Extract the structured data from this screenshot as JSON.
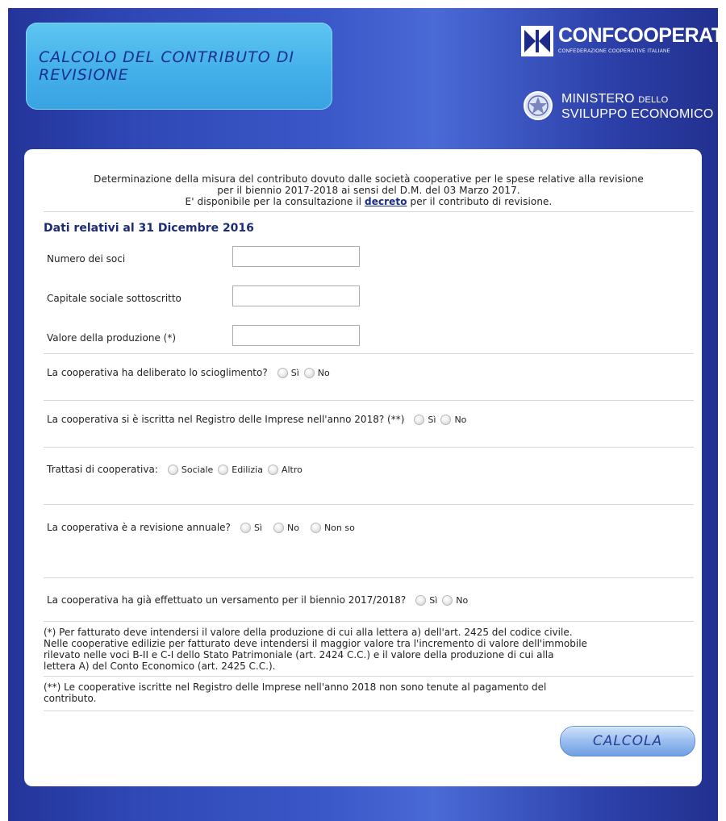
{
  "header": {
    "title": "CALCOLO DEL CONTRIBUTO DI REVISIONE",
    "logo1_name": "CONFCOOPERATIVE",
    "logo1_sub": "CONFEDERAZIONE COOPERATIVE ITALIANE",
    "logo2_line1_a": "MINISTERO ",
    "logo2_line1_b": "DELLO",
    "logo2_line2": "SVILUPPO ECONOMICO"
  },
  "intro": {
    "line1": "Determinazione della misura del contributo dovuto dalle società cooperative per le spese relative alla revisione",
    "line2": "per il biennio 2017-2018 ai sensi del D.M. del 03 Marzo 2017.",
    "line3_pre": "E' disponibile per la consultazione il ",
    "line3_link": "decreto",
    "line3_post": " per il contributo di revisione."
  },
  "section_title": "Dati relativi al 31 Dicembre 2016",
  "fields": {
    "soci_label": "Numero dei soci",
    "soci_value": "",
    "capitale_label": "Capitale sociale sottoscritto",
    "capitale_value": "",
    "produzione_label": "Valore della produzione (*)",
    "produzione_value": ""
  },
  "questions": {
    "q1": "La cooperativa ha deliberato lo scioglimento?",
    "q2": "La cooperativa si è iscritta nel Registro delle Imprese nell'anno 2018? (**)",
    "q3": "Trattasi di cooperativa:",
    "q4": "La cooperativa è a revisione annuale?",
    "q5": "La cooperativa ha già effettuato un versamento per il biennio 2017/2018?"
  },
  "options": {
    "si": "Sì",
    "no": "No",
    "sociale": "Sociale",
    "edilizia": "Edilizia",
    "altro": "Altro",
    "non_so": "Non so"
  },
  "notes": {
    "n1_l1": "(*) Per fatturato deve intendersi il valore della produzione di cui alla lettera a) dell'art. 2425 del codice civile.",
    "n1_l2": "Nelle cooperative edilizie per fatturato deve intendersi il maggior valore tra l'incremento di valore dell'immobile",
    "n1_l3": "rilevato nelle voci B-II e C-I dello Stato Patrimoniale (art. 2424 C.C.) e il valore della produzione di cui alla",
    "n1_l4": "lettera A) del Conto Economico (art. 2425 C.C.).",
    "n2_l1": "(**) Le cooperative iscritte nel Registro delle Imprese nell'anno 2018 non sono tenute al pagamento del",
    "n2_l2": "contributo."
  },
  "button": {
    "label": "CALCOLA"
  }
}
